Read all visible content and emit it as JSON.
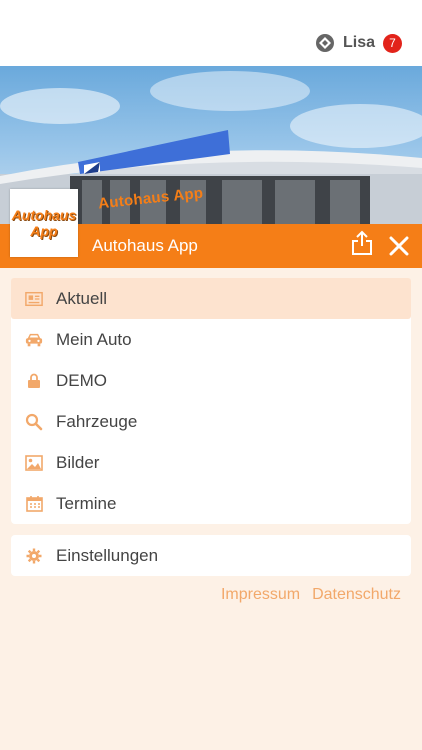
{
  "user": {
    "name": "Lisa",
    "badge_count": "7"
  },
  "hero": {
    "sign_text": "Autohaus App"
  },
  "header": {
    "logo_line1": "Autohaus",
    "logo_line2": "App",
    "title": "Autohaus App"
  },
  "menu": {
    "items": [
      {
        "label": "Aktuell",
        "icon": "news-icon",
        "active": true
      },
      {
        "label": "Mein Auto",
        "icon": "car-icon"
      },
      {
        "label": "DEMO",
        "icon": "lock-icon"
      },
      {
        "label": "Fahrzeuge",
        "icon": "search-icon"
      },
      {
        "label": "Bilder",
        "icon": "image-icon"
      },
      {
        "label": "Termine",
        "icon": "calendar-icon"
      }
    ],
    "settings": {
      "label": "Einstellungen",
      "icon": "gear-icon"
    }
  },
  "footer": {
    "impressum": "Impressum",
    "datenschutz": "Datenschutz"
  },
  "colors": {
    "accent": "#f57e17",
    "icon": "#f2a86a",
    "badge": "#e2231a",
    "background": "#fdf1e6"
  }
}
